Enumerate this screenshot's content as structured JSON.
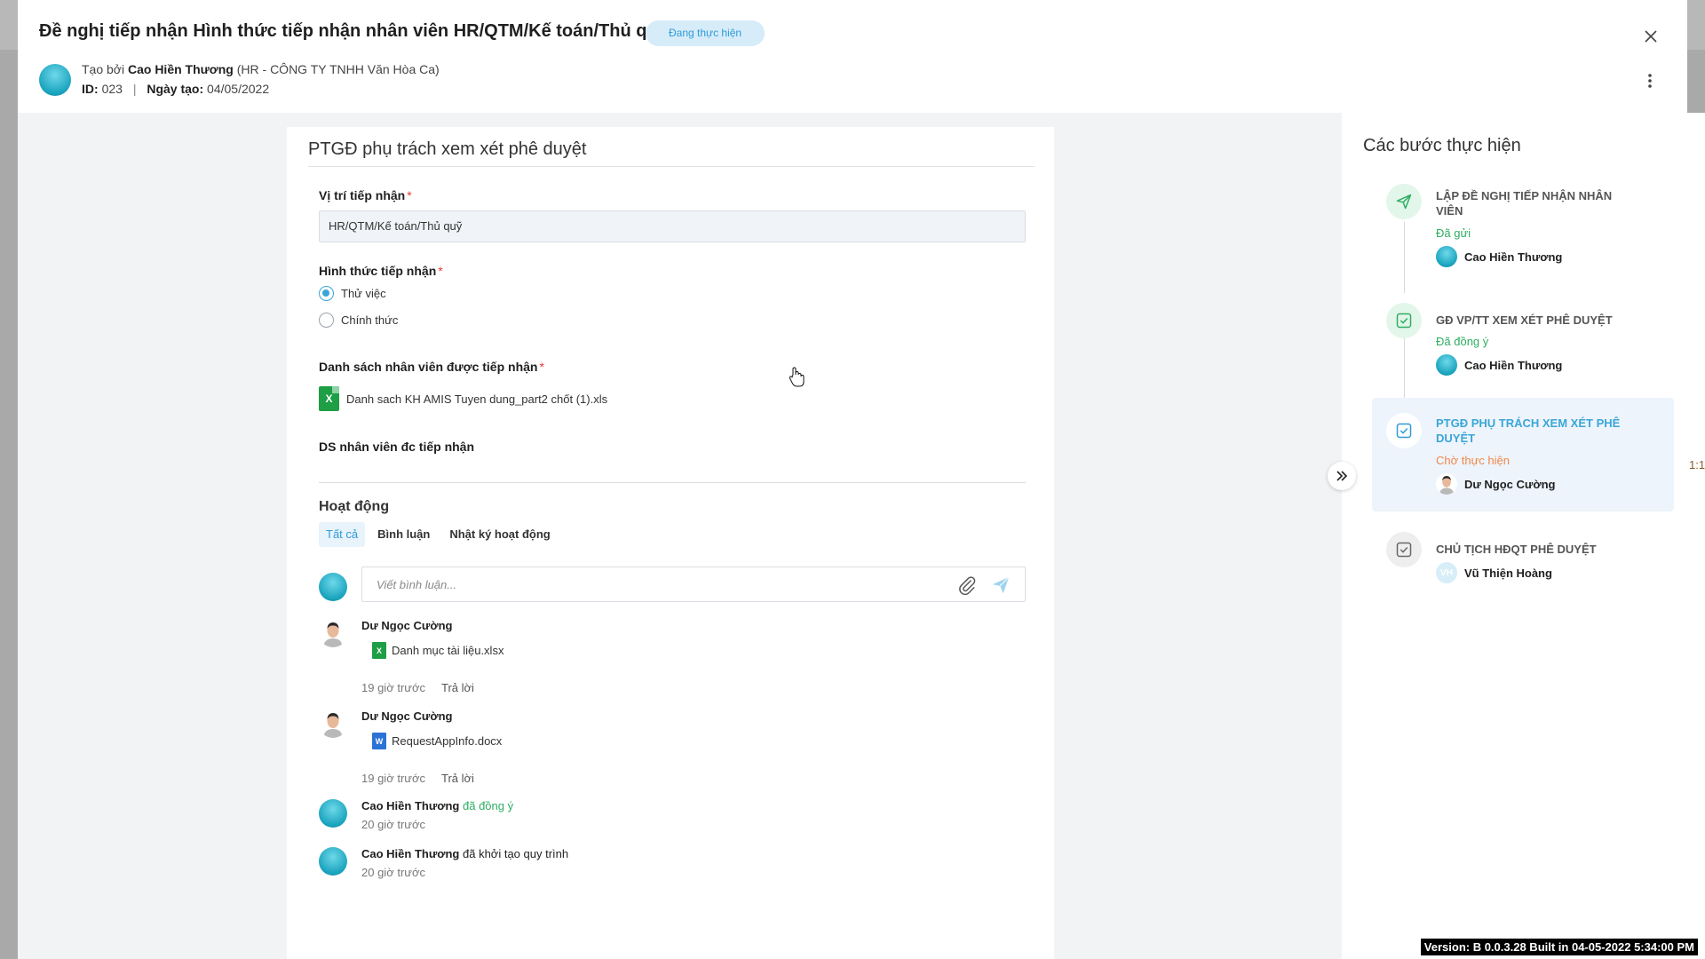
{
  "header": {
    "title": "Đề nghị tiếp nhận Hình thức tiếp nhận nhân viên HR/QTM/Kế toán/Thủ quỹ",
    "status": "Đang thực hiện",
    "created_by_label": "Tạo bởi",
    "creator_name": "Cao Hiền Thương",
    "creator_org": "(HR - CÔNG TY TNHH Văn Hòa Ca)",
    "id_label": "ID:",
    "id_value": "023",
    "separator": "|",
    "date_label": "Ngày tạo:",
    "date_value": "04/05/2022"
  },
  "form": {
    "section_title": "PTGĐ phụ trách xem xét phê duyệt",
    "position_label": "Vị trí tiếp nhận",
    "position_value": "HR/QTM/Kế toán/Thủ quỹ",
    "form_type_label": "Hình thức tiếp nhận",
    "options": [
      {
        "label": "Thử việc",
        "selected": true
      },
      {
        "label": "Chính thức",
        "selected": false
      }
    ],
    "employee_list_label": "Danh sách nhân viên được tiếp nhận",
    "employee_file": "Danh sach KH AMIS Tuyen dung_part2 chốt (1).xls",
    "accepted_list_label": "DS nhân viên đc tiếp nhận",
    "required_mark": "*"
  },
  "activity": {
    "title": "Hoạt động",
    "tabs": [
      "Tất cả",
      "Bình luận",
      "Nhật ký hoạt động"
    ],
    "comment_placeholder": "Viết bình luận...",
    "items": [
      {
        "name": "Dư Ngọc Cường",
        "file": "Danh mục tài liệu.xlsx",
        "time": "19 giờ trước",
        "reply": "Trả lời"
      },
      {
        "name": "Dư Ngọc Cường",
        "file": "RequestAppInfo.docx",
        "time": "19 giờ trước",
        "reply": "Trả lời"
      },
      {
        "name": "Cao Hiền Thương",
        "verb": "đã đồng ý",
        "time": "20 giờ trước"
      },
      {
        "name": "Cao Hiền Thương",
        "verb": "đã khởi tạo quy trình",
        "time": "20 giờ trước"
      }
    ]
  },
  "steps": {
    "title": "Các bước thực hiện",
    "items": [
      {
        "title": "LẬP ĐỀ NGHỊ TIẾP NHẬN NHÂN VIÊN",
        "status": "Đã gửi",
        "user": "Cao Hiền Thương"
      },
      {
        "title": "GĐ VP/TT XEM XÉT PHÊ DUYỆT",
        "status": "Đã đồng ý",
        "user": "Cao Hiền Thương"
      },
      {
        "title": "PTGĐ PHỤ TRÁCH XEM XÉT PHÊ DUYỆT",
        "status": "Chờ thực hiện",
        "user": "Dư Ngọc Cường"
      },
      {
        "title": "CHỦ TỊCH HĐQT PHÊ DUYỆT",
        "status": "",
        "user": "Vũ Thiện Hoàng",
        "initials": "VH"
      }
    ]
  },
  "backdrop_text": "1:1",
  "version": "Version: B 0.0.3.28 Built in 04-05-2022 5:34:00 PM",
  "icons": [
    "close-icon",
    "more-vertical-icon",
    "excel-file-icon",
    "word-file-icon",
    "paperclip-icon",
    "send-icon",
    "double-chevron-right-icon",
    "paper-plane-icon",
    "check-square-icon",
    "mouse-cursor-icon"
  ],
  "colors": {
    "accent": "#2f9ad8",
    "success": "#2eae62",
    "pending": "#f0874b",
    "excel": "#1e9e45",
    "word": "#2b74d6"
  }
}
